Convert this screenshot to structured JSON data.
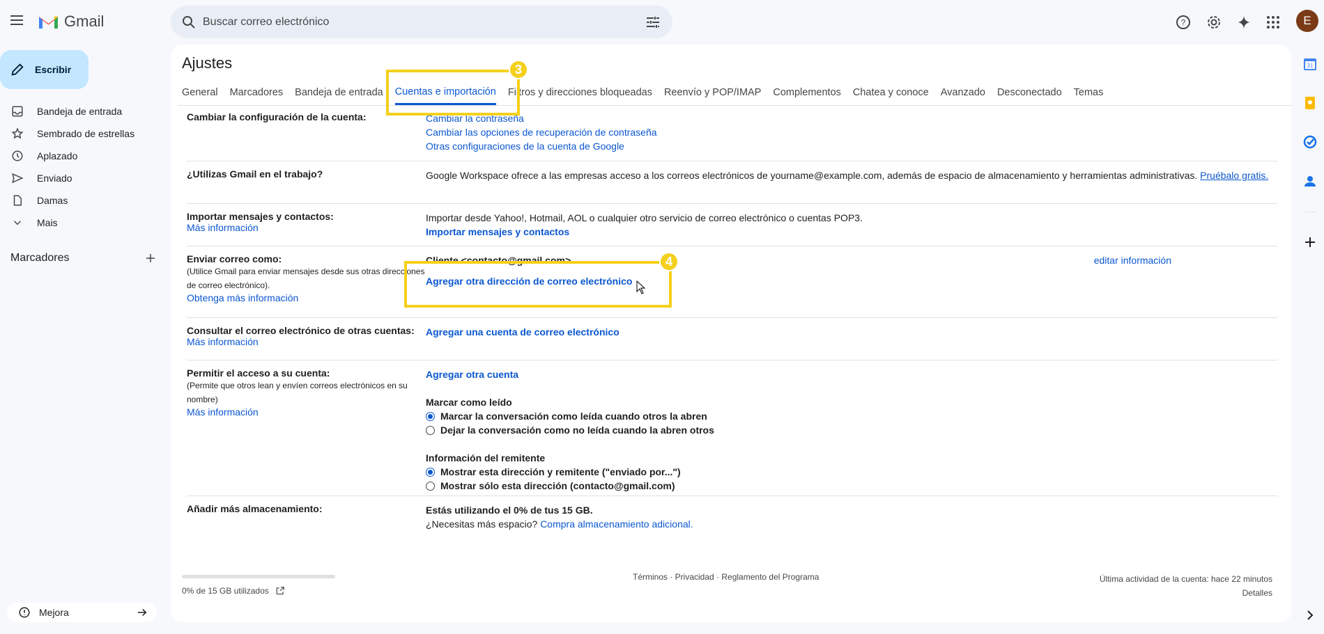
{
  "app": {
    "name": "Gmail",
    "search_placeholder": "Buscar correo electrónico",
    "avatar_letter": "E"
  },
  "sidebar": {
    "compose_label": "Escribir",
    "items": [
      {
        "label": "Bandeja de entrada",
        "icon": "inbox-icon"
      },
      {
        "label": "Sembrado de estrellas",
        "icon": "star-icon"
      },
      {
        "label": "Aplazado",
        "icon": "clock-icon"
      },
      {
        "label": "Enviado",
        "icon": "send-icon"
      },
      {
        "label": "Damas",
        "icon": "draft-icon"
      },
      {
        "label": "Mais",
        "icon": "chevron-down-icon"
      }
    ],
    "labels_heading": "Marcadores",
    "upgrade_label": "Mejora"
  },
  "settings": {
    "title": "Ajustes",
    "tabs": [
      "General",
      "Marcadores",
      "Bandeja de entrada",
      "Cuentas e importación",
      "Filtros y direcciones bloqueadas",
      "Reenvío y POP/IMAP",
      "Complementos",
      "Chatea y conoce",
      "Avanzado",
      "Desconectado",
      "Temas"
    ],
    "active_tab": "Cuentas e importación",
    "change_account": {
      "label": "Cambiar la configuración de la cuenta:",
      "links": [
        "Cambiar la contraseña",
        "Cambiar las opciones de recuperación de contraseña",
        "Otras configuraciones de la cuenta de Google"
      ]
    },
    "workspace": {
      "label": "¿Utilizas Gmail en el trabajo?",
      "text": "Google Workspace ofrece a las empresas acceso a los correos electrónicos de yourname@example.com, además de espacio de almacenamiento y herramientas administrativas.",
      "link": "Pruébalo gratis."
    },
    "import": {
      "label": "Importar mensajes y contactos:",
      "more": "Más información",
      "text": "Importar desde Yahoo!, Hotmail, AOL o cualquier otro servicio de correo electrónico o cuentas POP3.",
      "link": "Importar mensajes y contactos"
    },
    "send_as": {
      "label": "Enviar correo como:",
      "desc": "(Utilice Gmail para enviar mensajes desde sus otras direcciones de correo electrónico).",
      "more": "Obtenga más información",
      "account": "Cliente <contacto@gmail.com>",
      "edit": "editar información",
      "add": "Agregar otra dirección de correo electrónico"
    },
    "check_mail": {
      "label": "Consultar el correo electrónico de otras cuentas:",
      "more": "Más información",
      "link": "Agregar una cuenta de correo electrónico"
    },
    "grant_access": {
      "label": "Permitir el acceso a su cuenta:",
      "desc": "(Permite que otros lean y envíen correos electrónicos en su nombre)",
      "more": "Más información",
      "link": "Agregar otra cuenta",
      "mark_read_heading": "Marcar como leído",
      "mark_read_options": [
        "Marcar la conversación como leída cuando otros la abren",
        "Dejar la conversación como no leída cuando la abren otros"
      ],
      "sender_heading": "Información del remitente",
      "sender_options": [
        "Mostrar esta dirección y remitente (\"enviado por...\")",
        "Mostrar sólo esta dirección (contacto@gmail.com)"
      ]
    },
    "storage": {
      "label": "Añadir más almacenamiento:",
      "usage": "Estás utilizando el 0% de tus 15 GB.",
      "question": "¿Necesitas más espacio?",
      "link": "Compra almacenamiento adicional."
    }
  },
  "footer": {
    "usage": "0% de 15 GB utilizados",
    "usage_fraction": 0.0,
    "links": "Términos · Privacidad · Reglamento del Programa",
    "activity": "Última actividad de la cuenta: hace 22 minutos",
    "details": "Detalles"
  },
  "annotations": {
    "badge_tabs": "3",
    "badge_add_address": "4",
    "highlight_color": "#f4d01c"
  },
  "colors": {
    "accent": "#0b57d0",
    "compose_bg": "#c2e7ff",
    "page_bg": "#f6f8fc"
  }
}
